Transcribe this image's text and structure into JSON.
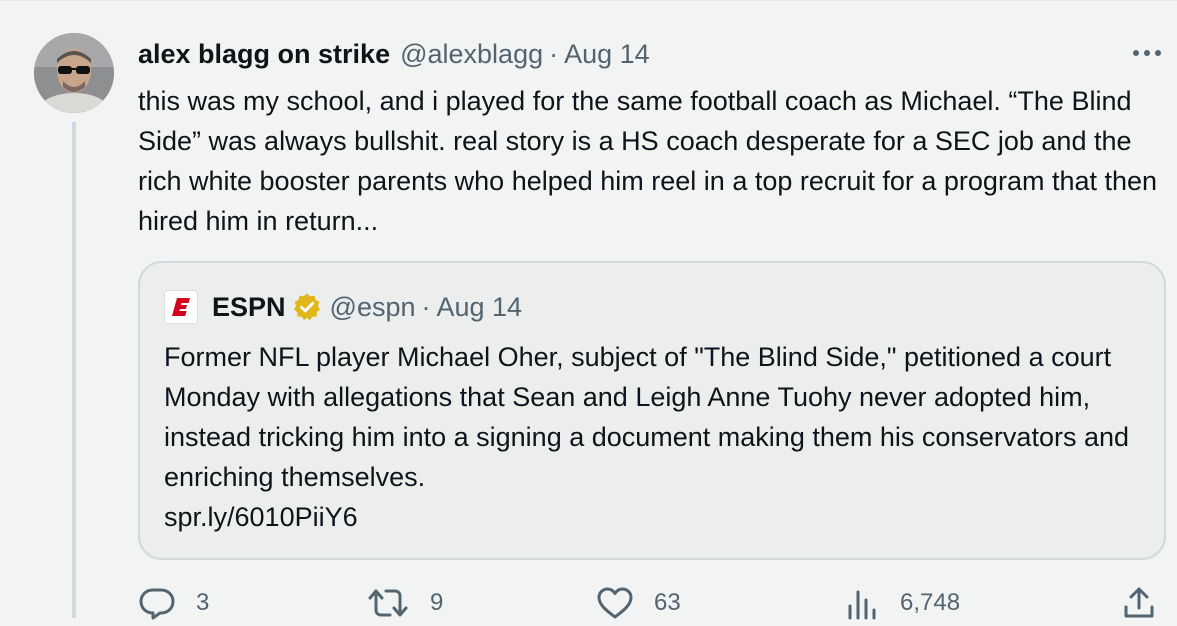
{
  "tweet": {
    "author_name": "alex blagg on strike",
    "author_handle": "@alexblagg",
    "separator": "·",
    "date": "Aug 14",
    "more_label": "···",
    "text": "this was my school, and i played for the same football coach as Michael. “The Blind Side” was always bullshit. real story is a HS coach desperate for a SEC job and the rich white booster parents who helped him reel in a top recruit for a program that then hired him in return..."
  },
  "quote": {
    "logo_letter": "E",
    "author_name": "ESPN",
    "author_handle": "@espn",
    "separator": "·",
    "date": "Aug 14",
    "text": "Former NFL player Michael Oher, subject of \"The Blind Side,\" petitioned a court Monday with allegations that Sean and Leigh Anne Tuohy never adopted him, instead tricking him into a signing a document making them his conservators and enriching themselves.",
    "link": "spr.ly/6010PiiY6"
  },
  "actions": {
    "replies": "3",
    "retweets": "9",
    "likes": "63",
    "views": "6,748"
  },
  "icons": {
    "reply": "speech-bubble-icon",
    "retweet": "retweet-arrows-icon",
    "like": "heart-icon",
    "views": "bar-chart-icon",
    "share": "share-upload-icon",
    "verified": "gold-verified-badge-icon"
  },
  "colors": {
    "espn_red": "#d4001e",
    "verified_gold": "#e2b719",
    "secondary_text": "#536471"
  }
}
